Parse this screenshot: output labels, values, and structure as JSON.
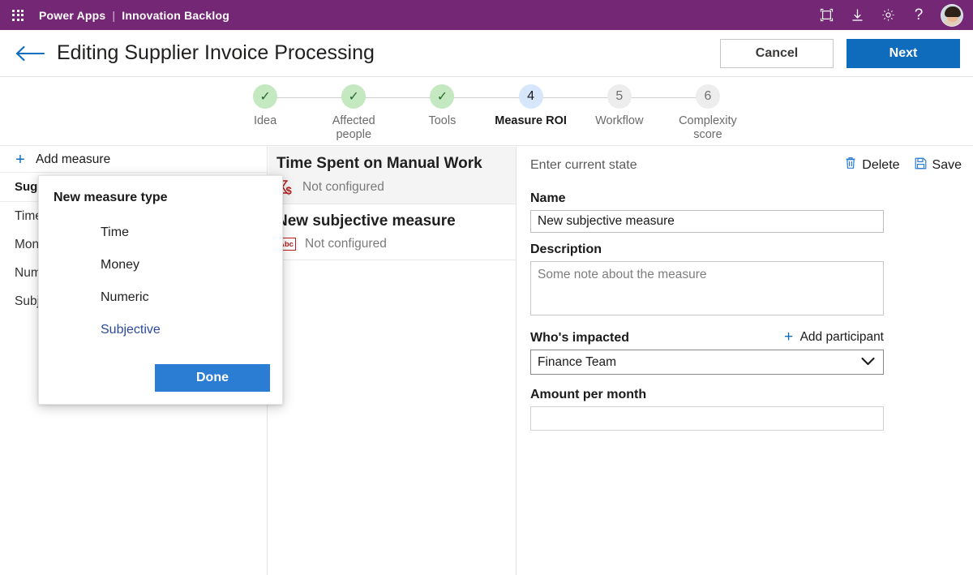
{
  "suitebar": {
    "waffle_icon": "waffle-grid-icon",
    "brand": "Power Apps",
    "separator": "|",
    "app_name": "Innovation Backlog",
    "icons": [
      {
        "name": "fullscreen-icon",
        "glyph": "frame"
      },
      {
        "name": "download-icon",
        "glyph": "download"
      },
      {
        "name": "gear-icon",
        "glyph": "gear"
      },
      {
        "name": "help-icon",
        "glyph": "?"
      }
    ],
    "avatar_alt": "user-avatar"
  },
  "header": {
    "back_icon": "back-arrow-icon",
    "title": "Editing Supplier Invoice Processing",
    "cancel_label": "Cancel",
    "next_label": "Next"
  },
  "stepper": {
    "steps": [
      {
        "num": "1",
        "label": "Idea",
        "state": "done",
        "mark": "✓"
      },
      {
        "num": "2",
        "label": "Affected people",
        "state": "done",
        "mark": "✓"
      },
      {
        "num": "3",
        "label": "Tools",
        "state": "done",
        "mark": "✓"
      },
      {
        "num": "4",
        "label": "Measure ROI",
        "state": "active",
        "mark": "4"
      },
      {
        "num": "5",
        "label": "Workflow",
        "state": "todo",
        "mark": "5"
      },
      {
        "num": "6",
        "label": "Complexity score",
        "state": "todo",
        "mark": "6"
      }
    ]
  },
  "left_panel": {
    "add_measure_label": "Add measure",
    "group_header": "Suggested",
    "items": [
      {
        "label": "Time"
      },
      {
        "label": "Money"
      },
      {
        "label": "Numeric"
      },
      {
        "label": "Subjective"
      }
    ]
  },
  "mid_panel": {
    "cards": [
      {
        "title": "Time Spent on Manual Work",
        "state": "Not configured",
        "icon": "hourglass-money-icon",
        "selected": true
      },
      {
        "title": "New subjective measure",
        "state": "Not configured",
        "icon": "abc-icon",
        "selected": false
      }
    ]
  },
  "right_panel": {
    "header_title": "Enter current state",
    "delete_label": "Delete",
    "save_label": "Save",
    "name_label": "Name",
    "name_value": "New subjective measure",
    "description_label": "Description",
    "description_placeholder": "Some note about the measure",
    "description_value": "",
    "impacted_label": "Who's impacted",
    "add_participant_label": "Add participant",
    "impacted_value": "Finance Team",
    "impacted_options": [
      "Finance Team"
    ],
    "amount_label": "Amount per month",
    "amount_value": ""
  },
  "dialog": {
    "title": "New measure type",
    "options": [
      {
        "label": "Time",
        "selected": false
      },
      {
        "label": "Money",
        "selected": false
      },
      {
        "label": "Numeric",
        "selected": false
      },
      {
        "label": "Subjective",
        "selected": true
      }
    ],
    "done_label": "Done"
  },
  "colors": {
    "suite_purple": "#742774",
    "primary_blue": "#0f6cbd",
    "dialog_blue": "#2b7cd3",
    "step_done_green": "#c4e8c0",
    "step_active_blue": "#d6e7fb",
    "icon_red": "#b81c1c"
  }
}
